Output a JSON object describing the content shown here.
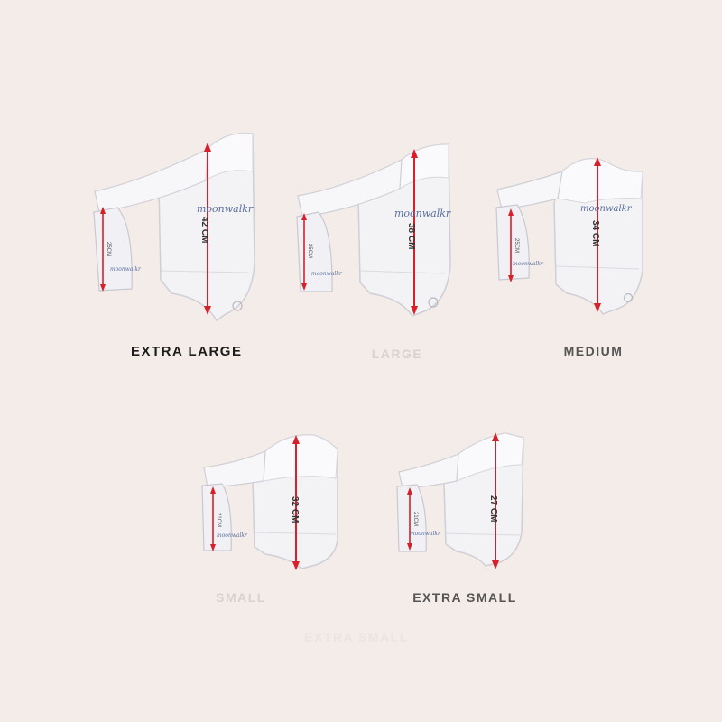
{
  "colors": {
    "background": "#f4ece8",
    "pad": "#f3f3f6",
    "pad_shadow": "#c9c9d0",
    "arrow": "#d8202a",
    "brand": "#5a6f9e"
  },
  "pads": [
    {
      "size_label": "EXTRA LARGE",
      "main_measure": "42 CM",
      "inner_measure": "25CM",
      "brand": "moonwalkr"
    },
    {
      "size_label": "LARGE",
      "main_measure": "38 CM",
      "inner_measure": "25CM",
      "brand": "moonwalkr"
    },
    {
      "size_label": "MEDIUM",
      "main_measure": "34 CM",
      "inner_measure": "25CM",
      "brand": "moonwalkr"
    },
    {
      "size_label": "SMALL",
      "main_measure": "32 CM",
      "inner_measure": "21CM",
      "brand": "moonwalkr"
    },
    {
      "size_label": "EXTRA SMALL",
      "main_measure": "27 CM",
      "inner_measure": "21CM",
      "brand": "moonwalkr"
    }
  ],
  "ghost_label": "EXTRA SMALL"
}
